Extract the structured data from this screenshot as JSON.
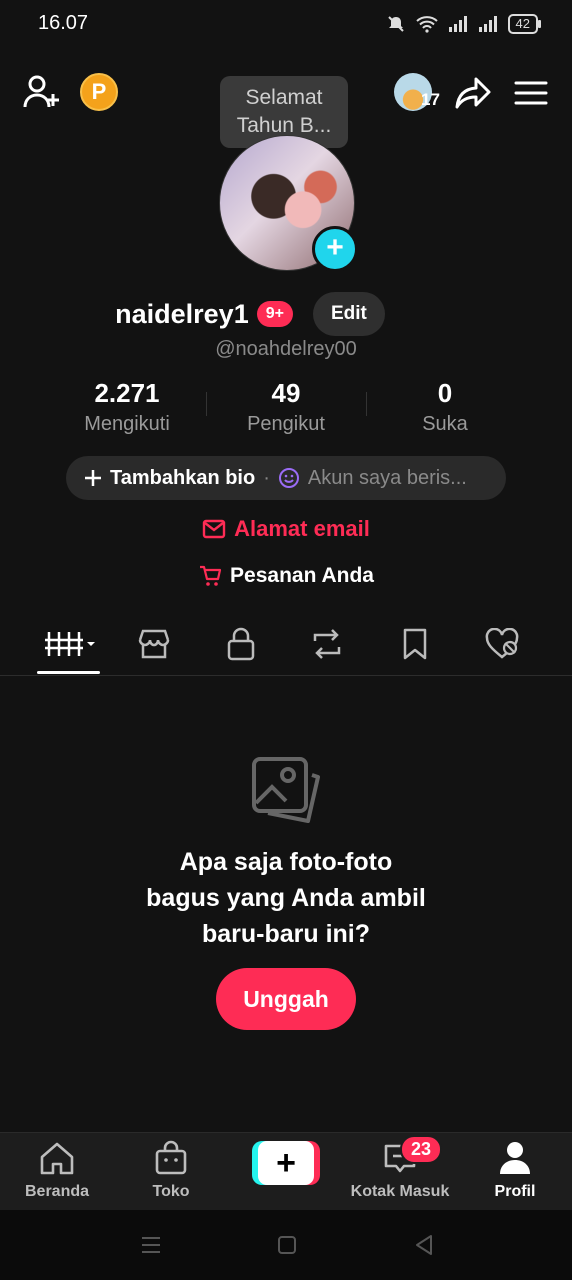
{
  "status_bar": {
    "time": "16.07",
    "battery": "42"
  },
  "header": {
    "tooltip_line1": "Selamat",
    "tooltip_line2": "Tahun B...",
    "coin_letter": "P",
    "story_count": "17"
  },
  "profile": {
    "username": "naidelrey1",
    "notification_badge": "9+",
    "edit_label": "Edit",
    "handle": "@noahdelrey00"
  },
  "stats": [
    {
      "value": "2.271",
      "label": "Mengikuti"
    },
    {
      "value": "49",
      "label": "Pengikut"
    },
    {
      "value": "0",
      "label": "Suka"
    }
  ],
  "bio": {
    "add_label": "Tambahkan bio",
    "separator": "·",
    "status_text": "Akun saya beris..."
  },
  "links": {
    "email_label": "Alamat email",
    "orders_label": "Pesanan Anda"
  },
  "tabs": [
    "grid-tab",
    "shop-tab",
    "private-tab",
    "repost-tab",
    "saved-tab",
    "liked-tab"
  ],
  "empty_state": {
    "line1": "Apa saja foto-foto",
    "line2": "bagus yang Anda ambil",
    "line3": "baru-baru ini?",
    "button_label": "Unggah"
  },
  "bottom_nav": {
    "home": "Beranda",
    "shop": "Toko",
    "create": "+",
    "inbox": "Kotak Masuk",
    "inbox_badge": "23",
    "profile": "Profil"
  },
  "colors": {
    "accent": "#fe2c55",
    "cyan": "#20d5ec",
    "background": "#121212"
  }
}
